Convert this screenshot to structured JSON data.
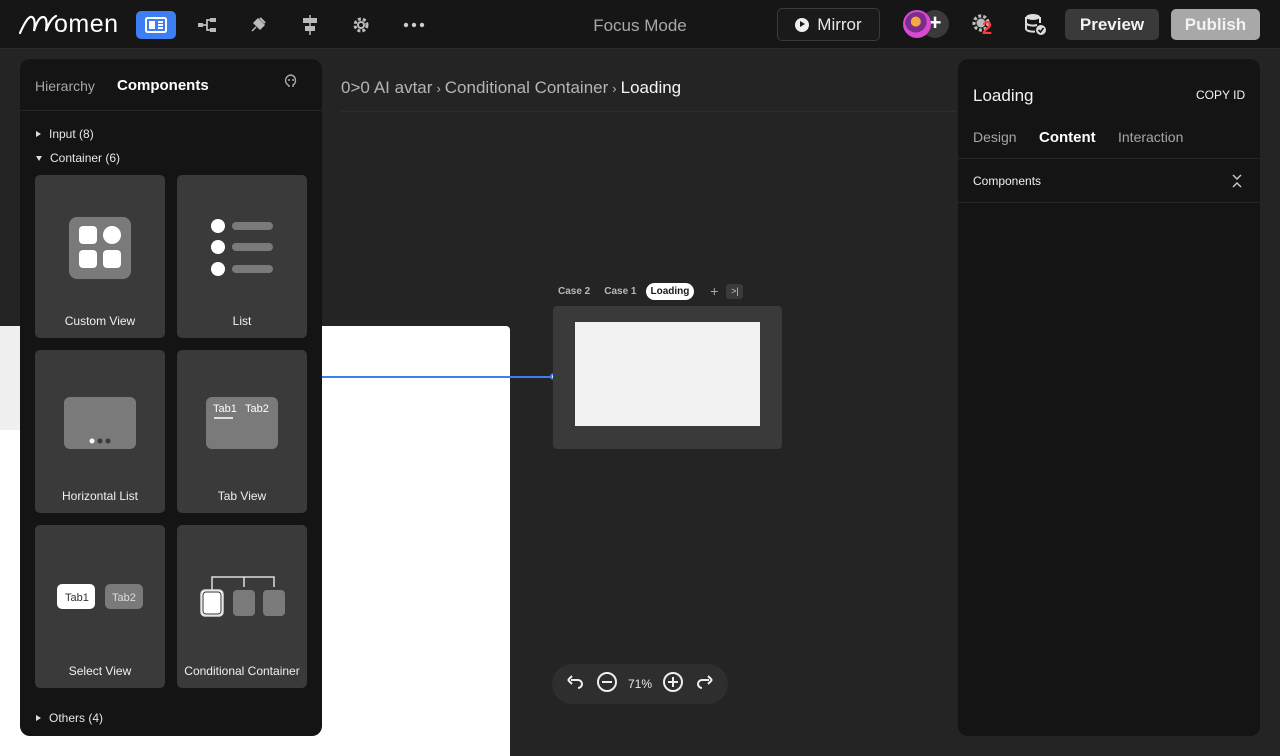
{
  "topbar": {
    "logo_text": "omen",
    "focus_mode": "Focus Mode",
    "mirror_label": "Mirror",
    "badge_count": "2",
    "preview_label": "Preview",
    "publish_label": "Publish",
    "accent_color": "#3d7ef3"
  },
  "left_panel": {
    "tabs": [
      {
        "label": "Hierarchy"
      },
      {
        "label": "Components"
      }
    ],
    "groups": [
      {
        "label": "Input (8)"
      },
      {
        "label": "Container (6)"
      },
      {
        "label": "Others (4)"
      }
    ],
    "components": [
      {
        "label": "Custom View"
      },
      {
        "label": "List"
      },
      {
        "label": "Horizontal List"
      },
      {
        "label": "Tab View"
      },
      {
        "label": "Select View"
      },
      {
        "label": "Conditional Container"
      }
    ],
    "tab_view_art": {
      "tab1": "Tab1",
      "tab2": "Tab2"
    },
    "select_view_art": {
      "tab1": "Tab1",
      "tab2": "Tab2"
    }
  },
  "breadcrumb": {
    "prefix": "0>0",
    "items": [
      "AI avtar",
      "Conditional Container",
      "Loading"
    ]
  },
  "canvas": {
    "case_tabs": [
      {
        "label": "Case 2"
      },
      {
        "label": "Case 1"
      },
      {
        "label": "Loading"
      }
    ],
    "zoom": "71%"
  },
  "right_panel": {
    "title": "Loading",
    "copy_id": "COPY ID",
    "tabs": [
      {
        "label": "Design"
      },
      {
        "label": "Content"
      },
      {
        "label": "Interaction"
      }
    ],
    "section": "Components"
  }
}
